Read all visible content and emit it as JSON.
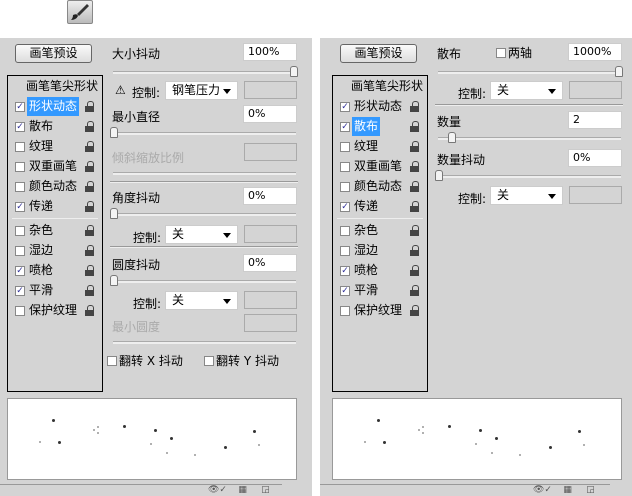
{
  "toolbar": {
    "brush_icon": "brush-icon"
  },
  "left": {
    "preset_button": "画笔预设",
    "list": [
      {
        "label": "画笔笔尖形状",
        "head": true
      },
      {
        "label": "形状动态",
        "checked": true,
        "selected": true
      },
      {
        "label": "散布",
        "checked": true
      },
      {
        "label": "纹理",
        "checked": false
      },
      {
        "label": "双重画笔",
        "checked": false
      },
      {
        "label": "颜色动态",
        "checked": false
      },
      {
        "label": "传递",
        "checked": true
      },
      {
        "label": "杂色",
        "checked": false
      },
      {
        "label": "湿边",
        "checked": false
      },
      {
        "label": "喷枪",
        "checked": true
      },
      {
        "label": "平滑",
        "checked": true
      },
      {
        "label": "保护纹理",
        "checked": false
      }
    ],
    "size_jitter": {
      "label": "大小抖动",
      "value": "100%",
      "slider": 1.0
    },
    "size_control": {
      "label": "控制:",
      "value": "钢笔压力",
      "warning_icon": "warning-icon"
    },
    "min_diameter": {
      "label": "最小直径",
      "value": "0%",
      "slider": 0
    },
    "tilt_scale": {
      "label": "倾斜缩放比例"
    },
    "angle_jitter": {
      "label": "角度抖动",
      "value": "0%",
      "slider": 0
    },
    "angle_control": {
      "label": "控制:",
      "value": "关"
    },
    "roundness_jitter": {
      "label": "圆度抖动",
      "value": "0%",
      "slider": 0
    },
    "roundness_control": {
      "label": "控制:",
      "value": "关"
    },
    "min_roundness": {
      "label": "最小圆度"
    },
    "flip_x": {
      "label": "翻转 X 抖动",
      "checked": false
    },
    "flip_y": {
      "label": "翻转 Y 抖动",
      "checked": false
    }
  },
  "right": {
    "preset_button": "画笔预设",
    "list": [
      {
        "label": "画笔笔尖形状",
        "head": true
      },
      {
        "label": "形状动态",
        "checked": true
      },
      {
        "label": "散布",
        "checked": true,
        "selected": true
      },
      {
        "label": "纹理",
        "checked": false
      },
      {
        "label": "双重画笔",
        "checked": false
      },
      {
        "label": "颜色动态",
        "checked": false
      },
      {
        "label": "传递",
        "checked": true
      },
      {
        "label": "杂色",
        "checked": false
      },
      {
        "label": "湿边",
        "checked": false
      },
      {
        "label": "喷枪",
        "checked": true
      },
      {
        "label": "平滑",
        "checked": true
      },
      {
        "label": "保护纹理",
        "checked": false
      }
    ],
    "scatter": {
      "label": "散布",
      "both_axes": "两轴",
      "both_axes_checked": false,
      "value": "1000%",
      "slider": 1.0
    },
    "scatter_control": {
      "label": "控制:",
      "value": "关"
    },
    "count": {
      "label": "数量",
      "value": "2",
      "slider": 0.07
    },
    "count_jitter": {
      "label": "数量抖动",
      "value": "0%",
      "slider": 0
    },
    "count_control": {
      "label": "控制:",
      "value": "关"
    }
  }
}
